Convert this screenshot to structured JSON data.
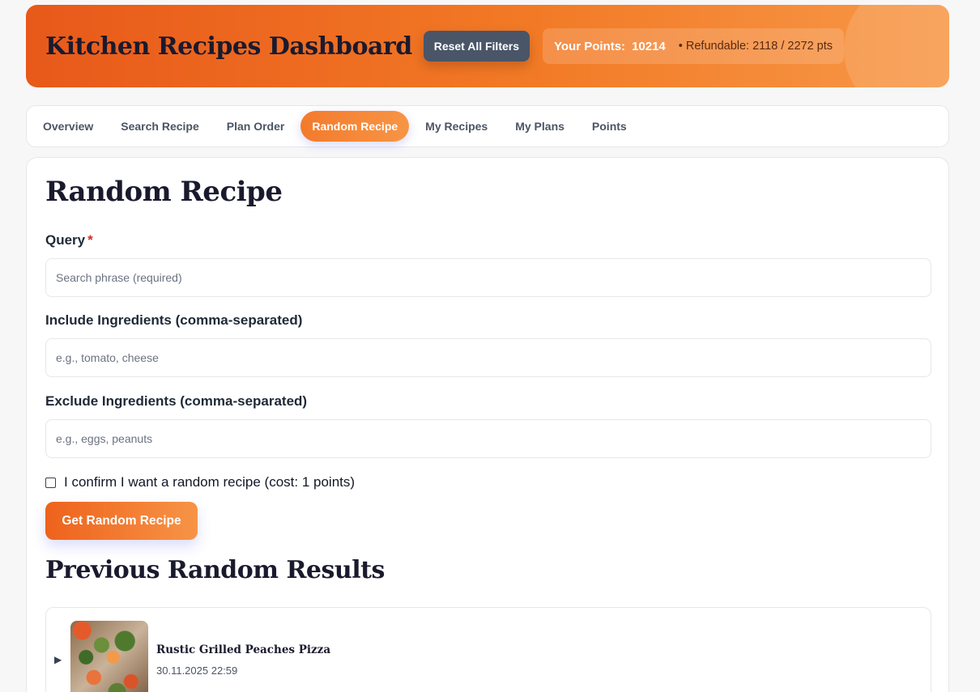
{
  "header": {
    "title": "Kitchen Recipes Dashboard",
    "reset_label": "Reset All Filters",
    "points_label": "Your Points:",
    "points_value": "10214",
    "refundable": "• Refundable: 2118 / 2272 pts"
  },
  "tabs": [
    {
      "label": "Overview",
      "active": false
    },
    {
      "label": "Search Recipe",
      "active": false
    },
    {
      "label": "Plan Order",
      "active": false
    },
    {
      "label": "Random Recipe",
      "active": true
    },
    {
      "label": "My Recipes",
      "active": false
    },
    {
      "label": "My Plans",
      "active": false
    },
    {
      "label": "Points",
      "active": false
    }
  ],
  "form": {
    "heading": "Random Recipe",
    "query_label": "Query",
    "query_required_mark": "*",
    "query_placeholder": "Search phrase (required)",
    "query_value": "",
    "include_label": "Include Ingredients (comma-separated)",
    "include_placeholder": "e.g., tomato, cheese",
    "include_value": "",
    "exclude_label": "Exclude Ingredients (comma-separated)",
    "exclude_placeholder": "e.g., eggs, peanuts",
    "exclude_value": "",
    "confirm_text": "I confirm I want a random recipe (cost: 1 points)",
    "confirm_checked": false,
    "submit_label": "Get Random Recipe"
  },
  "results": {
    "heading": "Previous Random Results",
    "items": [
      {
        "title": "Rustic Grilled Peaches Pizza",
        "date": "30.11.2025 22:59",
        "caret": "▶"
      }
    ]
  },
  "colors": {
    "accent": "#f27a26",
    "reset_button": "#4a5568",
    "required": "#dc2626"
  }
}
